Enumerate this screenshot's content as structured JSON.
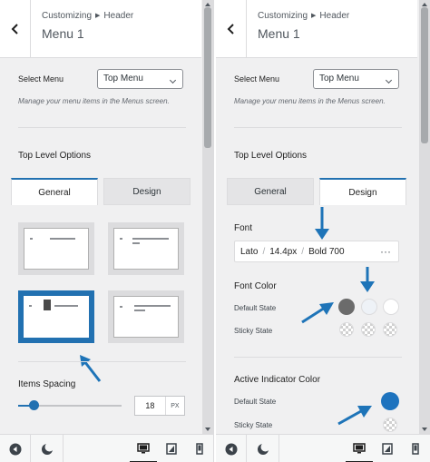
{
  "colors": {
    "accent": "#2271b1",
    "arrow": "#1e74b8",
    "swatch_gray": "#6b6b6b",
    "swatch_light": "#eef2f7",
    "swatch_white": "#ffffff",
    "indicator_blue": "#1e73be"
  },
  "left": {
    "header": {
      "breadcrumb_a": "Customizing",
      "breadcrumb_b": "Header",
      "title": "Menu 1"
    },
    "select_menu": {
      "label": "Select Menu",
      "value": "Top Menu",
      "hint": "Manage your menu items in the Menus screen."
    },
    "section_title": "Top Level Options",
    "tabs": [
      {
        "label": "General",
        "active": true
      },
      {
        "label": "Design",
        "active": false
      }
    ],
    "items_spacing": {
      "label": "Items Spacing",
      "value": "18",
      "unit": "PX",
      "level": 0.15
    }
  },
  "right": {
    "header": {
      "breadcrumb_a": "Customizing",
      "breadcrumb_b": "Header",
      "title": "Menu 1"
    },
    "select_menu": {
      "label": "Select Menu",
      "value": "Top Menu",
      "hint": "Manage your menu items in the Menus screen."
    },
    "section_title": "Top Level Options",
    "tabs": [
      {
        "label": "General",
        "active": false
      },
      {
        "label": "Design",
        "active": true
      }
    ],
    "font": {
      "label": "Font",
      "family": "Lato",
      "size": "14.4px",
      "weight": "Bold 700",
      "more": "···"
    },
    "font_color": {
      "label": "Font Color",
      "default_state": "Default State",
      "sticky_state": "Sticky State"
    },
    "active_indicator": {
      "label": "Active Indicator Color",
      "default_state": "Default State",
      "sticky_state": "Sticky State"
    }
  },
  "icons": [
    "back-arrow-icon",
    "chevron-down-icon",
    "previous-icon",
    "dark-mode-icon",
    "desktop-icon",
    "tablet-icon",
    "mobile-icon",
    "ellipsis-icon"
  ]
}
